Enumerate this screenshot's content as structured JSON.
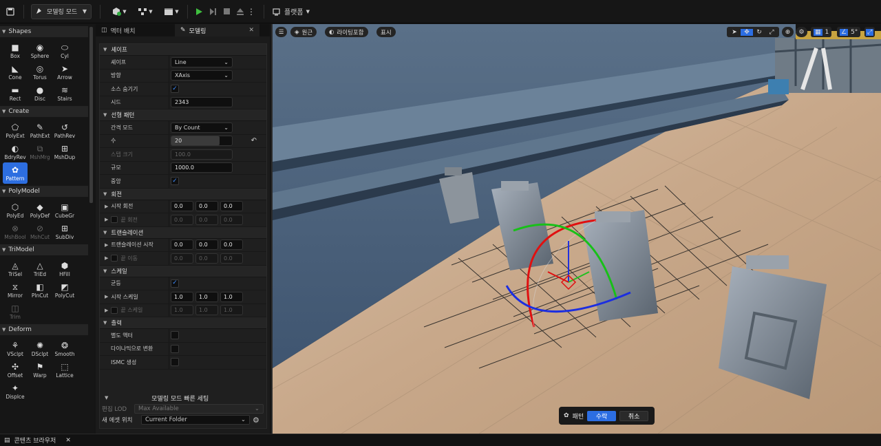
{
  "toolbar": {
    "mode_label": "모델링 모드",
    "platform_label": "플랫폼"
  },
  "left_panel": {
    "categories": [
      {
        "label": "Shapes",
        "tools": [
          {
            "label": "Box",
            "icon": "box-icon"
          },
          {
            "label": "Sphere",
            "icon": "sphere-icon"
          },
          {
            "label": "Cyl",
            "icon": "cylinder-icon"
          },
          {
            "label": "Cone",
            "icon": "cone-icon"
          },
          {
            "label": "Torus",
            "icon": "torus-icon"
          },
          {
            "label": "Arrow",
            "icon": "arrow-icon"
          },
          {
            "label": "Rect",
            "icon": "rect-icon"
          },
          {
            "label": "Disc",
            "icon": "disc-icon"
          },
          {
            "label": "Stairs",
            "icon": "stairs-icon"
          }
        ]
      },
      {
        "label": "Create",
        "tools": [
          {
            "label": "PolyExt",
            "icon": "polyext-icon"
          },
          {
            "label": "PathExt",
            "icon": "pathext-icon"
          },
          {
            "label": "PathRev",
            "icon": "pathrev-icon"
          },
          {
            "label": "BdryRev",
            "icon": "bdryrev-icon"
          },
          {
            "label": "MshMrg",
            "icon": "meshmerge-icon"
          },
          {
            "label": "MshDup",
            "icon": "meshdup-icon"
          },
          {
            "label": "Pattern",
            "icon": "pattern-icon"
          }
        ]
      },
      {
        "label": "PolyModel",
        "tools": [
          {
            "label": "PolyEd",
            "icon": "polyed-icon"
          },
          {
            "label": "PolyDef",
            "icon": "polydef-icon"
          },
          {
            "label": "CubeGr",
            "icon": "cubegrid-icon"
          },
          {
            "label": "MshBool",
            "icon": "meshbool-icon"
          },
          {
            "label": "MshCut",
            "icon": "meshcut-icon"
          },
          {
            "label": "SubDiv",
            "icon": "subdiv-icon"
          }
        ]
      },
      {
        "label": "TriModel",
        "tools": [
          {
            "label": "TriSel",
            "icon": "trisel-icon"
          },
          {
            "label": "TriEd",
            "icon": "tried-icon"
          },
          {
            "label": "HFill",
            "icon": "holefill-icon"
          },
          {
            "label": "Mirror",
            "icon": "mirror-icon"
          },
          {
            "label": "PlnCut",
            "icon": "planecut-icon"
          },
          {
            "label": "PolyCut",
            "icon": "polycut-icon"
          },
          {
            "label": "Trim",
            "icon": "trim-icon"
          }
        ]
      },
      {
        "label": "Deform",
        "tools": [
          {
            "label": "VSclpt",
            "icon": "vsculpt-icon"
          },
          {
            "label": "DSclpt",
            "icon": "dsculpt-icon"
          },
          {
            "label": "Smooth",
            "icon": "smooth-icon"
          },
          {
            "label": "Offset",
            "icon": "offset-icon"
          },
          {
            "label": "Warp",
            "icon": "warp-icon"
          },
          {
            "label": "Lattice",
            "icon": "lattice-icon"
          },
          {
            "label": "Displce",
            "icon": "displace-icon"
          }
        ]
      }
    ]
  },
  "tabs": {
    "actor_place": "액터 배치",
    "modeling": "모델링"
  },
  "props": {
    "shape": {
      "header": "셰이프",
      "shape_label": "셰이프",
      "shape_value": "Line",
      "direction_label": "방향",
      "direction_value": "XAxis",
      "hide_source_label": "소스 숨기기",
      "seed_label": "시드",
      "seed_value": "2343"
    },
    "linear": {
      "header": "선형 패턴",
      "spacing_label": "간격 모드",
      "spacing_value": "By Count",
      "count_label": "수",
      "count_value": "20",
      "step_label": "스텝 크기",
      "step_value": "100.0",
      "extent_label": "규모",
      "extent_value": "1000.0",
      "centered_label": "중앙"
    },
    "rotation": {
      "header": "회전",
      "start_label": "시작 회전",
      "start": [
        "0.0",
        "0.0",
        "0.0"
      ],
      "end_label": "끝 회전",
      "end": [
        "0.0",
        "0.0",
        "0.0"
      ]
    },
    "translation": {
      "header": "트랜슬레이션",
      "start_label": "트랜슬레이션 시작",
      "start": [
        "0.0",
        "0.0",
        "0.0"
      ],
      "end_label": "끝 이동",
      "end": [
        "0.0",
        "0.0",
        "0.0"
      ]
    },
    "scale": {
      "header": "스케일",
      "uniform_label": "균등",
      "start_label": "시작 스케일",
      "start": [
        "1.0",
        "1.0",
        "1.0"
      ],
      "end_label": "끝 스케일",
      "end": [
        "1.0",
        "1.0",
        "1.0"
      ]
    },
    "output": {
      "header": "출력",
      "separate_label": "별도 액터",
      "dynamic_label": "다이나믹으로 변환",
      "ismc_label": "ISMC 생성"
    }
  },
  "quick": {
    "title": "모델링 모드 빠른 세팅",
    "lod_label": "편집 LOD",
    "lod_value": "Max Available",
    "asset_label": "새 에셋 위치",
    "asset_value": "Current Folder"
  },
  "viewport": {
    "perspective": "원근",
    "lighting": "라이팅포함",
    "show": "표시",
    "grid_value": "1",
    "angle_value": "5°"
  },
  "accept_bar": {
    "tool_name": "패턴",
    "accept": "수락",
    "cancel": "취소"
  },
  "status": {
    "content_browser": "콘텐츠 브라우저"
  }
}
